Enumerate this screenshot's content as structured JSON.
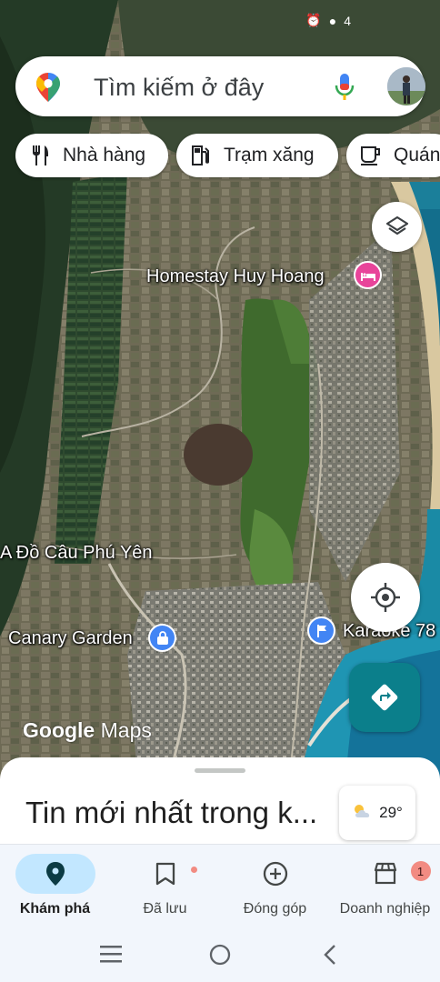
{
  "status_bar": {
    "alarm_icon": "alarm-icon",
    "location_icon": "location-icon",
    "count": "4"
  },
  "search": {
    "placeholder": "Tìm kiếm ở đây"
  },
  "chips": [
    {
      "label": "Nhà hàng",
      "icon": "restaurant-icon"
    },
    {
      "label": "Trạm xăng",
      "icon": "gas-station-icon"
    },
    {
      "label": "Quán",
      "icon": "coffee-icon"
    }
  ],
  "map": {
    "places": {
      "homestay": "Homestay Huy Hoang",
      "trail": "A Đồ Câu Phú Yên",
      "canary": "Canary Garden",
      "karaoke": "Karaoke 78"
    },
    "watermark": {
      "google": "Google",
      "maps": "Maps"
    },
    "colors": {
      "hotel_marker": "#e8449a",
      "shop_marker": "#4285f4",
      "directions": "#0b7f8b"
    }
  },
  "sheet": {
    "title": "Tin mới nhất trong k..."
  },
  "weather": {
    "temp": "29°"
  },
  "nav": [
    {
      "label": "Khám phá",
      "icon": "explore-pin-icon",
      "active": true
    },
    {
      "label": "Đã lưu",
      "icon": "bookmark-icon"
    },
    {
      "label": "Đóng góp",
      "icon": "add-circle-icon"
    },
    {
      "label": "Doanh nghiệp",
      "icon": "business-store-icon",
      "badge": "1"
    }
  ]
}
